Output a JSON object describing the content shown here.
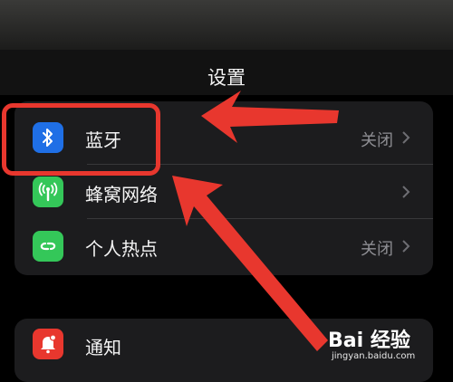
{
  "header": {
    "title": "设置"
  },
  "settings": [
    {
      "label": "蓝牙",
      "value": "关闭",
      "icon": "bluetooth-icon",
      "color": "#1f6fe6"
    },
    {
      "label": "蜂窝网络",
      "value": "",
      "icon": "cellular-antenna-icon",
      "color": "#34c759"
    },
    {
      "label": "个人热点",
      "value": "关闭",
      "icon": "hotspot-link-icon",
      "color": "#34c759"
    }
  ],
  "settings2": [
    {
      "label": "通知",
      "icon": "bell-icon",
      "color": "#e8372e"
    }
  ],
  "annotation": {
    "color": "#e8372e"
  },
  "watermark": {
    "logo": "Bai 经验",
    "url": "jingyan.baidu.com"
  }
}
